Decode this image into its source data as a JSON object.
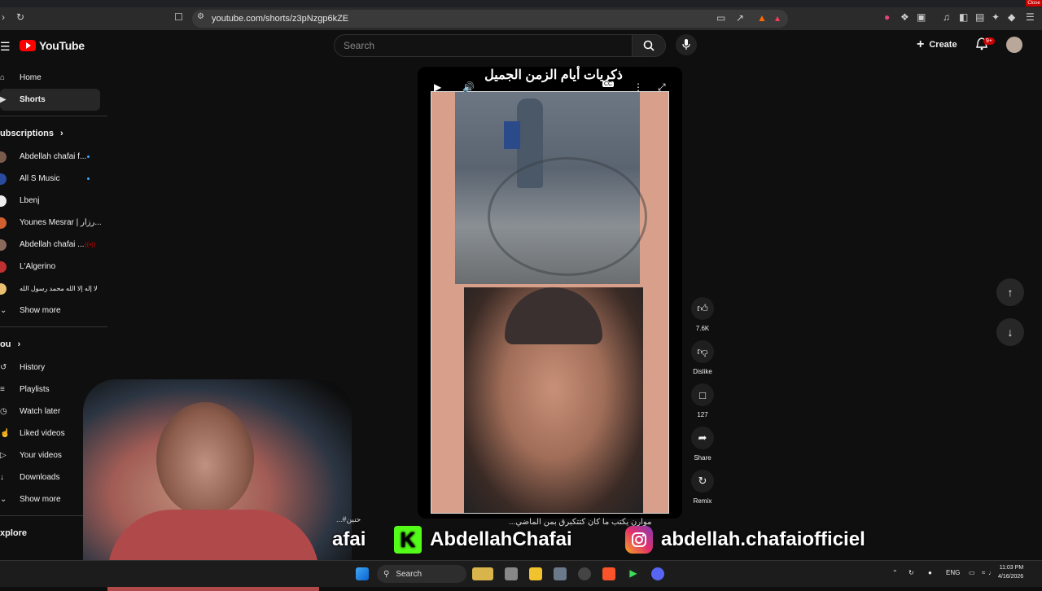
{
  "browser": {
    "url": "youtube.com/shorts/z3pNzgp6kZE",
    "close_label": "Close"
  },
  "header": {
    "logo_text": "YouTube",
    "search_placeholder": "Search",
    "create_label": "Create",
    "notif_badge": "9+"
  },
  "sidebar": {
    "main": [
      {
        "label": "Home",
        "icon": "home-icon"
      },
      {
        "label": "Shorts",
        "icon": "shorts-icon",
        "active": true
      }
    ],
    "subs_title": "ubscriptions",
    "subs": [
      {
        "label": "Abdellah chafai f...",
        "color": "#7a5a4a",
        "new": true
      },
      {
        "label": "All S Music",
        "color": "#2a4aa0",
        "new": true
      },
      {
        "label": "Lbenj",
        "color": "#eeeeee",
        "new": false
      },
      {
        "label": "Younes Mesrar | رزار...",
        "color": "#d06030",
        "new": false
      },
      {
        "label": "Abdellah chafai ...",
        "color": "#8a6a5a",
        "new": false,
        "live": true
      },
      {
        "label": "L'Algerino",
        "color": "#c03030",
        "new": false
      },
      {
        "label": "لا إله إلا الله محمد رسول الله",
        "color": "#e8c070",
        "new": false
      }
    ],
    "show_more_1": "Show more",
    "you_title": "ou",
    "you_items": [
      "History",
      "Playlists",
      "Watch later",
      "Liked videos",
      "Your videos",
      "Downloads"
    ],
    "show_more_2": "Show more",
    "explore_title": "xplore"
  },
  "short": {
    "overlay_title": "ذكريات أيام الزمن الجميل",
    "cc_label": "CC",
    "caption": "...موارن يكتب ما كان كتتكبرق بمن الماضي",
    "caption_left": "...#حنين"
  },
  "actions": {
    "likes": "7.6K",
    "dislike": "Dislike",
    "comments": "127",
    "share": "Share",
    "remix": "Remix"
  },
  "promo": {
    "left_text": "afai",
    "kick_handle": "AbdellahChafai",
    "ig_handle": "abdellah.chafaiofficiel"
  },
  "taskbar": {
    "search_label": "Search",
    "lang": "ENG",
    "time": "11:03 PM",
    "date": "4/16/2026"
  }
}
